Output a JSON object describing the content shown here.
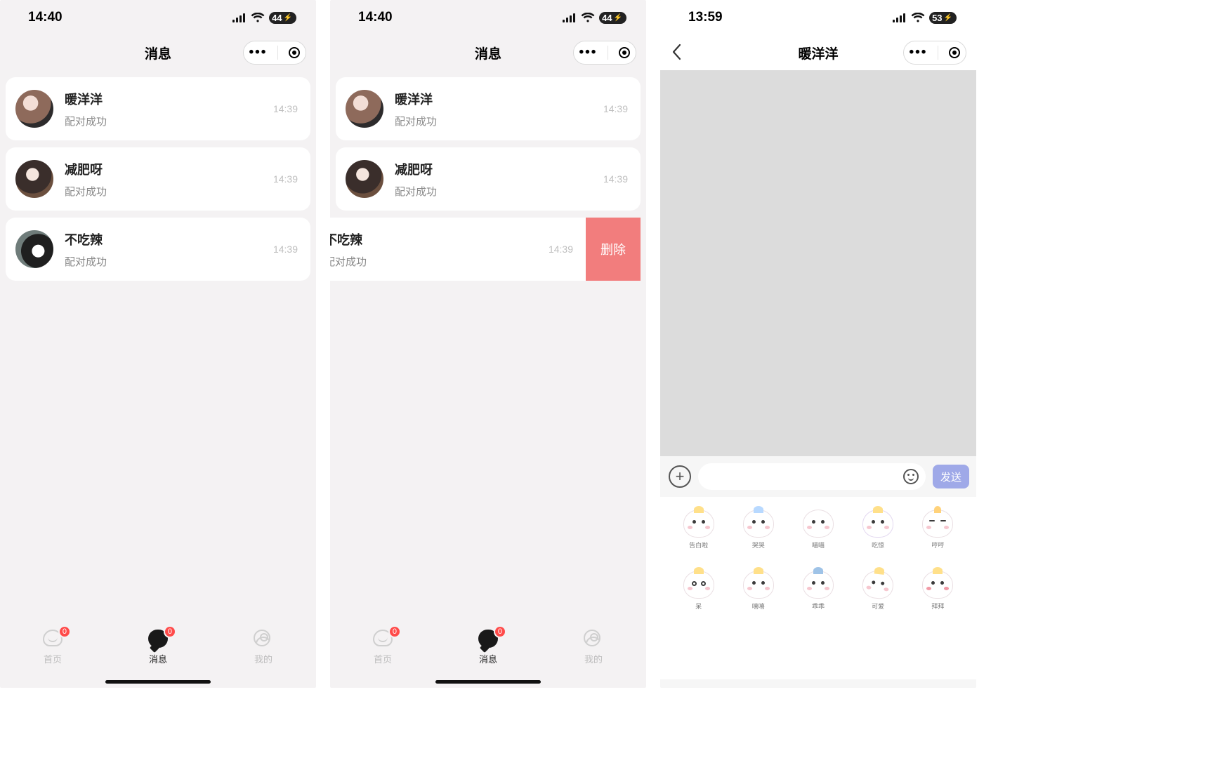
{
  "screens": {
    "left": {
      "status_time": "14:40",
      "status_battery": "44",
      "header_title": "消息",
      "conversations": [
        {
          "name": "暖洋洋",
          "sub": "配对成功",
          "time": "14:39"
        },
        {
          "name": "减肥呀",
          "sub": "配对成功",
          "time": "14:39"
        },
        {
          "name": "不吃辣",
          "sub": "配对成功",
          "time": "14:39"
        }
      ],
      "tabs": {
        "home": "首页",
        "msg": "消息",
        "mine": "我的",
        "badge_home": "0",
        "badge_msg": "0"
      }
    },
    "middle": {
      "status_time": "14:40",
      "status_battery": "44",
      "header_title": "消息",
      "conversations": [
        {
          "name": "暖洋洋",
          "sub": "配对成功",
          "time": "14:39"
        },
        {
          "name": "减肥呀",
          "sub": "配对成功",
          "time": "14:39"
        },
        {
          "name": "不吃辣",
          "sub": "配对成功",
          "time": "14:39"
        }
      ],
      "delete_label": "删除",
      "tabs": {
        "home": "首页",
        "msg": "消息",
        "mine": "我的",
        "badge_home": "0",
        "badge_msg": "0"
      }
    },
    "right": {
      "status_time": "13:59",
      "status_battery": "53",
      "header_title": "暖洋洋",
      "send_label": "发送",
      "stickers_row1": [
        "告白啦",
        "哭哭",
        "喵喵",
        "吃惊",
        "哼哼"
      ],
      "stickers_row2": [
        "呆",
        "嘻嘻",
        "乖乖",
        "可爱",
        "拜拜"
      ]
    }
  }
}
